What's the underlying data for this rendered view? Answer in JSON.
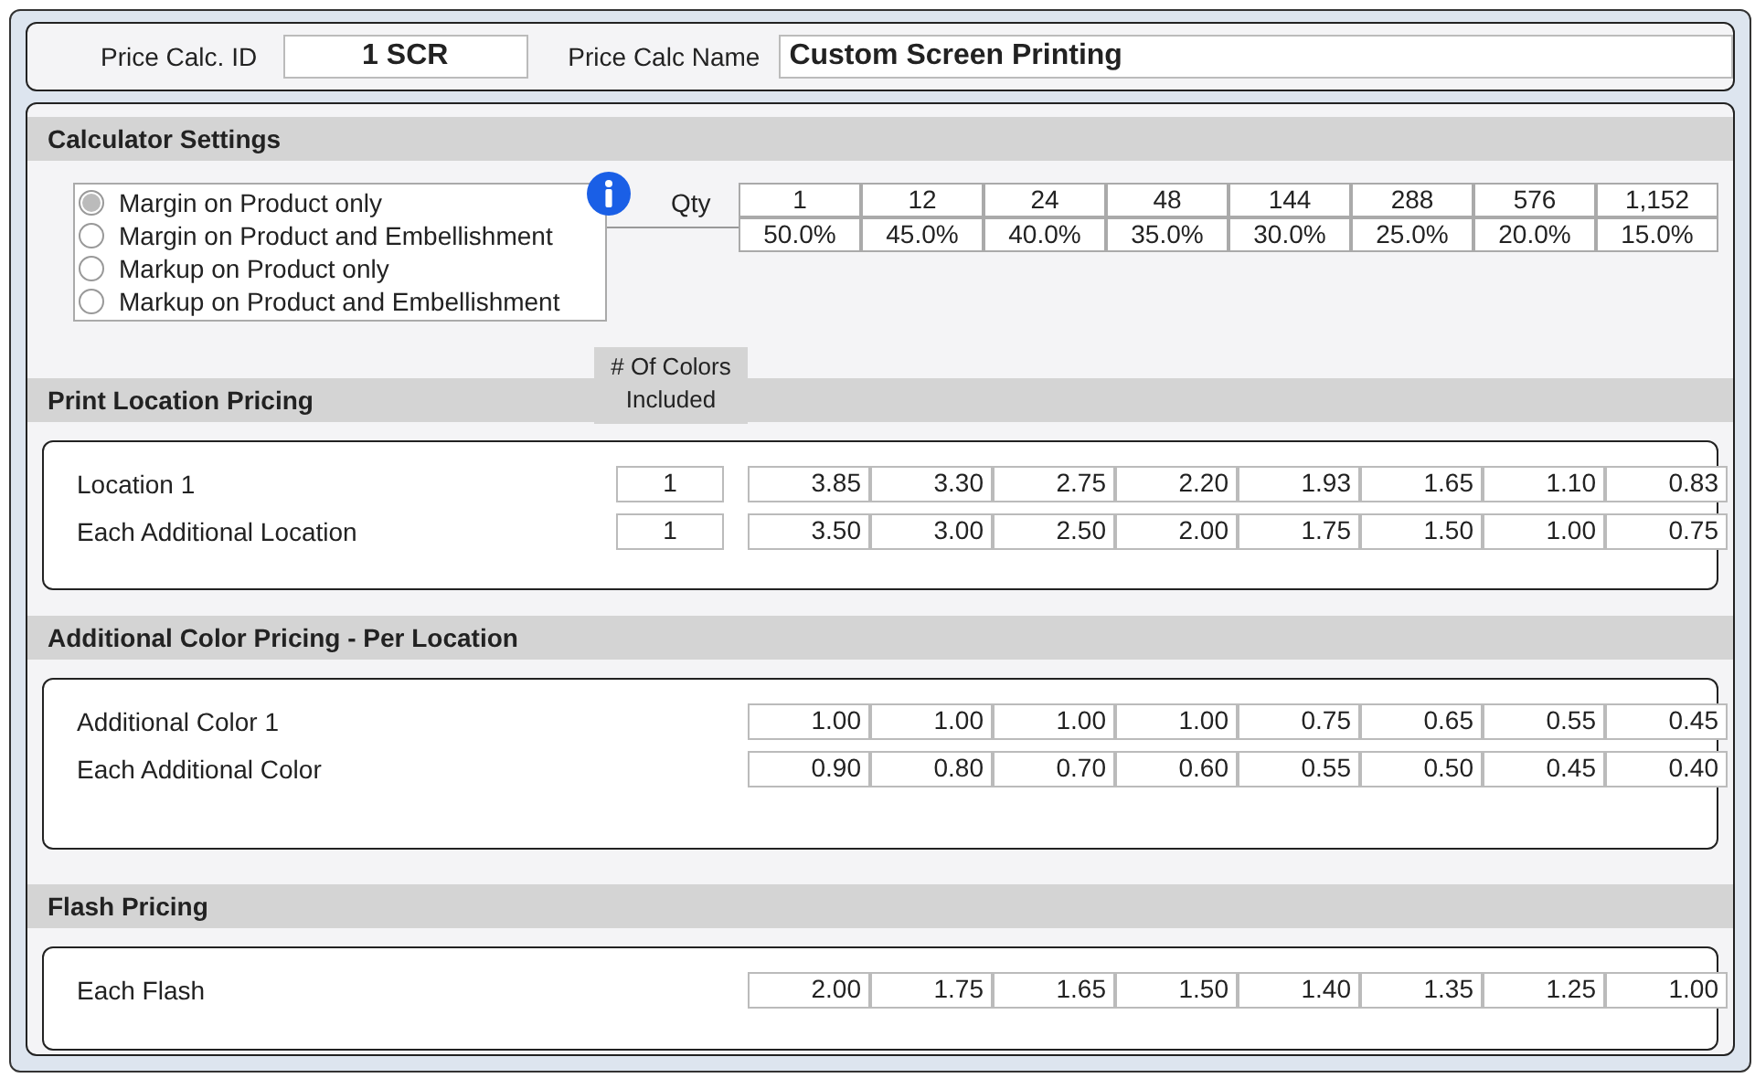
{
  "header": {
    "id_label": "Price Calc. ID",
    "id_value": "1 SCR",
    "name_label": "Price Calc Name",
    "name_value": "Custom Screen Printing"
  },
  "calculator_settings": {
    "title": "Calculator Settings",
    "options": [
      {
        "label": "Margin on Product only",
        "selected": true
      },
      {
        "label": "Margin on Product and Embellishment",
        "selected": false
      },
      {
        "label": "Markup on Product only",
        "selected": false
      },
      {
        "label": "Markup on Product and Embellishment",
        "selected": false
      }
    ],
    "qty_label": "Qty",
    "quantities": [
      "1",
      "12",
      "24",
      "48",
      "144",
      "288",
      "576",
      "1,152"
    ],
    "percentages": [
      "50.0%",
      "45.0%",
      "40.0%",
      "35.0%",
      "30.0%",
      "25.0%",
      "20.0%",
      "15.0%"
    ]
  },
  "sections": [
    {
      "title": "Print Location Pricing",
      "colors_header": "# Of Colors Included",
      "rows": [
        {
          "label": "Location 1",
          "colors_included": "1",
          "prices": [
            "3.85",
            "3.30",
            "2.75",
            "2.20",
            "1.93",
            "1.65",
            "1.10",
            "0.83"
          ]
        },
        {
          "label": "Each Additional Location",
          "colors_included": "1",
          "prices": [
            "3.50",
            "3.00",
            "2.50",
            "2.00",
            "1.75",
            "1.50",
            "1.00",
            "0.75"
          ]
        }
      ]
    },
    {
      "title": "Additional Color Pricing - Per Location",
      "rows": [
        {
          "label": "Additional Color 1",
          "prices": [
            "1.00",
            "1.00",
            "1.00",
            "1.00",
            "0.75",
            "0.65",
            "0.55",
            "0.45"
          ]
        },
        {
          "label": "Each Additional Color",
          "prices": [
            "0.90",
            "0.80",
            "0.70",
            "0.60",
            "0.55",
            "0.50",
            "0.45",
            "0.40"
          ]
        }
      ]
    },
    {
      "title": "Flash Pricing",
      "rows": [
        {
          "label": "Each Flash",
          "prices": [
            "2.00",
            "1.75",
            "1.65",
            "1.50",
            "1.40",
            "1.35",
            "1.25",
            "1.00"
          ]
        }
      ]
    }
  ]
}
